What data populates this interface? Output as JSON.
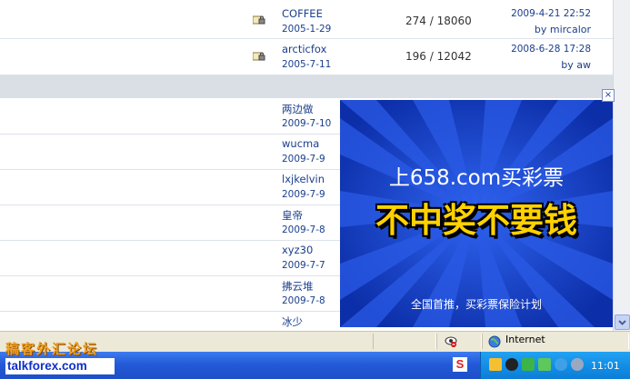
{
  "thread_rows": [
    {
      "author": "COFFEE",
      "author_date": "2005-1-29",
      "counts": "274 / 18060",
      "last_post": "2009-4-21 22:52",
      "last_by": "by mircalor"
    },
    {
      "author": "arcticfox",
      "author_date": "2005-7-11",
      "counts": "196 / 12042",
      "last_post": "2008-6-28 17:28",
      "last_by": "by aw"
    }
  ],
  "lower_rows": [
    {
      "author": "两边做",
      "author_date": "2009-7-10"
    },
    {
      "author": "wucma",
      "author_date": "2009-7-9"
    },
    {
      "author": "lxjkelvin",
      "author_date": "2009-7-9"
    },
    {
      "author": "皇帝",
      "author_date": "2009-7-8"
    },
    {
      "author": "xyz30",
      "author_date": "2009-7-7"
    },
    {
      "author": "拂云堆",
      "author_date": "2009-7-8"
    },
    {
      "author": "冰少",
      "author_date": ""
    }
  ],
  "ad": {
    "close": "×",
    "line1": "上658.com买彩票",
    "line2": "不中奖不要钱",
    "line3": "全国首推，买彩票保险计划",
    "bg_color": "#1340c8",
    "accent_color": "#ffd200"
  },
  "statusbar": {
    "zone": "Internet",
    "zone_icon": "globe-icon"
  },
  "taskbar": {
    "clock": "11:01"
  },
  "watermark": {
    "line1": "稿客外汇论坛",
    "line2": "talkforex.com"
  },
  "icons": [
    "lock-folder-icon",
    "globe-icon",
    "sogou-icon",
    "scroll-down-icon"
  ]
}
